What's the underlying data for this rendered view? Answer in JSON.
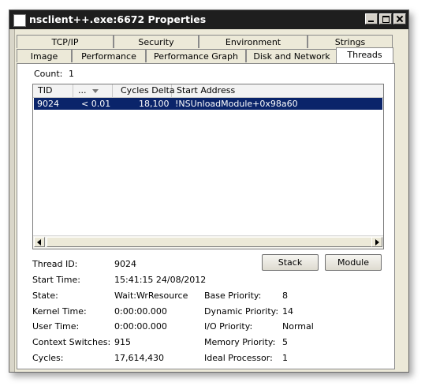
{
  "window": {
    "title": "nsclient++.exe:6672 Properties"
  },
  "tabs_row1": [
    "TCP/IP",
    "Security",
    "Environment",
    "Strings"
  ],
  "tabs_row2": [
    "Image",
    "Performance",
    "Performance Graph",
    "Disk and Network",
    "Threads"
  ],
  "active_tab": "Threads",
  "threads": {
    "count_label": "Count:",
    "count_value": "1",
    "columns": [
      "TID",
      "...",
      "Cycles Delta",
      "Start Address"
    ],
    "rows": [
      {
        "tid": "9024",
        "cpu": "< 0.01",
        "cycles_delta": "18,100",
        "start_address": "!NSUnloadModule+0x98a60",
        "selected": true
      }
    ]
  },
  "buttons": {
    "stack": "Stack",
    "module": "Module"
  },
  "details": {
    "thread_id": {
      "label": "Thread ID:",
      "value": "9024"
    },
    "start_time": {
      "label": "Start Time:",
      "value": "15:41:15  24/08/2012"
    },
    "state": {
      "label": "State:",
      "value": "Wait:WrResource"
    },
    "kernel_time": {
      "label": "Kernel Time:",
      "value": "0:00:00.000"
    },
    "user_time": {
      "label": "User Time:",
      "value": "0:00:00.000"
    },
    "context_switches": {
      "label": "Context Switches:",
      "value": "915"
    },
    "cycles": {
      "label": "Cycles:",
      "value": "17,614,430"
    },
    "base_priority": {
      "label": "Base Priority:",
      "value": "8"
    },
    "dynamic_priority": {
      "label": "Dynamic Priority:",
      "value": "14"
    },
    "io_priority": {
      "label": "I/O Priority:",
      "value": "Normal"
    },
    "memory_priority": {
      "label": "Memory Priority:",
      "value": "5"
    },
    "ideal_processor": {
      "label": "Ideal Processor:",
      "value": "1"
    }
  },
  "colors": {
    "selection": "#0a246a",
    "titlebar": "#1e1e1e",
    "dialog_bg": "#ece9d8"
  }
}
